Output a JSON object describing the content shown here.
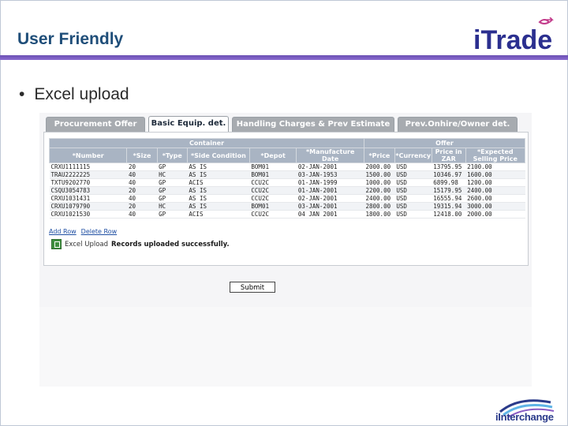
{
  "slide": {
    "title": "User Friendly",
    "bullet": "Excel upload",
    "logo_text": "iTrade",
    "footer_logo_text": "iInterchange"
  },
  "app": {
    "tabs": [
      {
        "label": "Procurement Offer",
        "active": false
      },
      {
        "label": "Basic Equip. det.",
        "active": true
      },
      {
        "label": "Handling Charges & Prev Estimate",
        "active": false
      },
      {
        "label": "Prev.Onhire/Owner det.",
        "active": false
      }
    ],
    "table": {
      "group_headers": {
        "container": "Container",
        "offer": "Offer"
      },
      "columns": [
        "*Number",
        "*Size",
        "*Type",
        "*Side Condition",
        "*Depot",
        "*Manufacture Date",
        "*Price",
        "*Currency",
        "Price in ZAR",
        "*Expected Selling Price"
      ],
      "rows": [
        [
          "CRXU1111115",
          "20",
          "GP",
          "AS IS",
          "BOM01",
          "02-JAN-2001",
          "2000.00",
          "USD",
          "13795.95",
          "2100.00"
        ],
        [
          "TRAU2222225",
          "40",
          "HC",
          "AS IS",
          "BOM01",
          "03-JAN-1953",
          "1500.00",
          "USD",
          "10346.97",
          "1600.00"
        ],
        [
          "TXTU9202770",
          "40",
          "GP",
          "ACIS",
          "CCU2C",
          "01-JAN-1999",
          "1000.00",
          "USD",
          "6899.98",
          "1200.00"
        ],
        [
          "CSQU3054783",
          "20",
          "GP",
          "AS IS",
          "CCU2C",
          "01-JAN-2001",
          "2200.00",
          "USD",
          "15179.95",
          "2400.00"
        ],
        [
          "CRXU1031431",
          "40",
          "GP",
          "AS IS",
          "CCU2C",
          "02-JAN-2001",
          "2400.00",
          "USD",
          "16555.94",
          "2600.00"
        ],
        [
          "CRXU1079790",
          "20",
          "HC",
          "AS IS",
          "BOM01",
          "03-JAN-2001",
          "2800.00",
          "USD",
          "19315.94",
          "3000.00"
        ],
        [
          "CRXU1021530",
          "40",
          "GP",
          "ACIS",
          "CCU2C",
          "04 JAN 2001",
          "1800.00",
          "USD",
          "12418.00",
          "2000.00"
        ]
      ]
    },
    "links": {
      "add_row": "Add Row",
      "delete_row": "Delete Row"
    },
    "upload": {
      "label": "Excel Upload",
      "message": "Records uploaded successfully."
    },
    "submit_label": "Submit"
  }
}
